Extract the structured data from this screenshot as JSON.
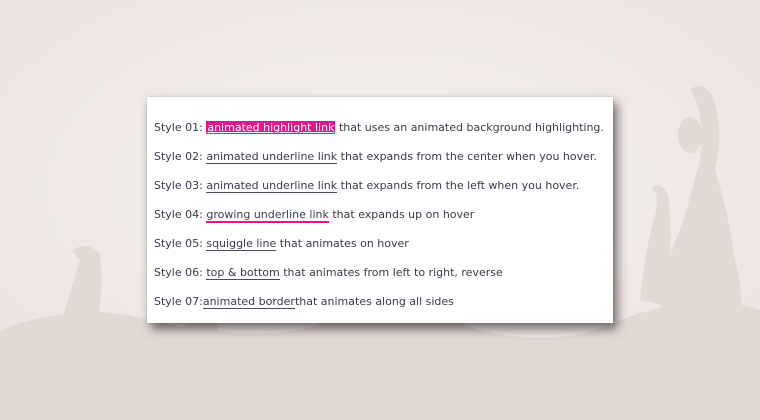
{
  "colors": {
    "accent": "#e0178a",
    "text": "#3a3a4a",
    "background": "#f1ebe9"
  },
  "rows": [
    {
      "prefix": "Style 01:",
      "link": "animated highlight link",
      "suffix": "that uses an animated background highlighting."
    },
    {
      "prefix": "Style 02:",
      "link": "animated underline link",
      "suffix": "that expands from the center when you hover."
    },
    {
      "prefix": "Style 03:",
      "link": "animated underline link",
      "suffix": "that expands from the left when you hover."
    },
    {
      "prefix": "Style 04:",
      "link": "growing underline link",
      "suffix": "that expands up on hover"
    },
    {
      "prefix": "Style 05:",
      "link": "squiggle line",
      "suffix": "that animates on hover"
    },
    {
      "prefix": "Style 06:",
      "link": "top & bottom",
      "suffix": "that animates from left to right, reverse"
    },
    {
      "prefix": "Style 07:",
      "link": "animated border",
      "suffix": "that animates along all sides"
    }
  ]
}
